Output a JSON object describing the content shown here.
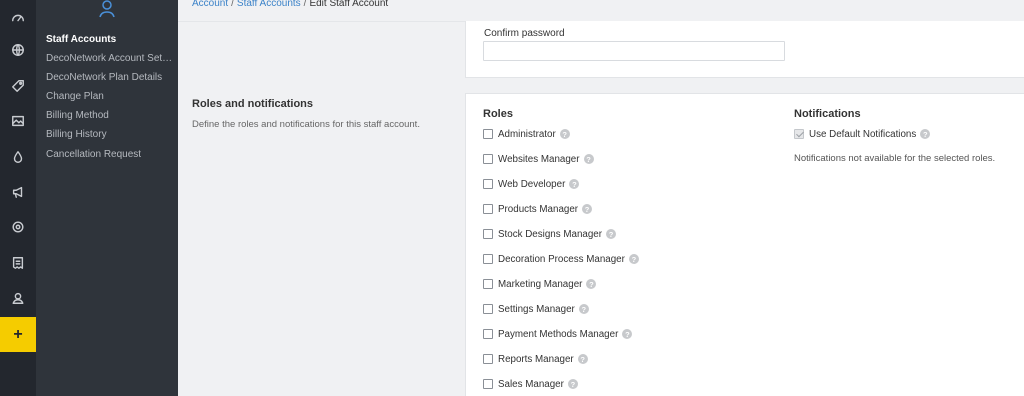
{
  "rail": {
    "icons": [
      "dashboard-icon",
      "globe-icon",
      "tag-icon",
      "image-icon",
      "drop-icon",
      "megaphone-icon",
      "settings-icon",
      "receipt-icon",
      "user-icon",
      "plus-icon"
    ],
    "plus_label": "+",
    "active_color": "#f5cc00"
  },
  "subnav": {
    "items": [
      {
        "label": "Staff Accounts",
        "active": true
      },
      {
        "label": "DecoNetwork Account Setti..."
      },
      {
        "label": "DecoNetwork Plan Details"
      },
      {
        "label": "Change Plan"
      },
      {
        "label": "Billing Method"
      },
      {
        "label": "Billing History"
      },
      {
        "label": "Cancellation Request"
      }
    ]
  },
  "breadcrumb": {
    "items": [
      "Account",
      "Staff Accounts",
      "Edit Staff Account"
    ],
    "separator": "/"
  },
  "password_section": {
    "confirm_label": "Confirm password",
    "confirm_value": ""
  },
  "roles_section": {
    "title": "Roles and notifications",
    "description": "Define the roles and notifications for this staff account.",
    "roles_heading": "Roles",
    "roles": [
      {
        "label": "Administrator",
        "checked": false
      },
      {
        "label": "Websites Manager",
        "checked": false
      },
      {
        "label": "Web Developer",
        "checked": false
      },
      {
        "label": "Products Manager",
        "checked": false
      },
      {
        "label": "Stock Designs Manager",
        "checked": false
      },
      {
        "label": "Decoration Process Manager",
        "checked": false
      },
      {
        "label": "Marketing Manager",
        "checked": false
      },
      {
        "label": "Settings Manager",
        "checked": false
      },
      {
        "label": "Payment Methods Manager",
        "checked": false
      },
      {
        "label": "Reports Manager",
        "checked": false
      },
      {
        "label": "Sales Manager",
        "checked": false
      }
    ],
    "notifications_heading": "Notifications",
    "use_default_label": "Use Default Notifications",
    "use_default_checked": true,
    "use_default_disabled": true,
    "notifications_note": "Notifications not available for the selected roles."
  },
  "colors": {
    "link": "#3a82c8",
    "rail_bg": "#23272e",
    "subnav_bg": "#2f343b"
  }
}
